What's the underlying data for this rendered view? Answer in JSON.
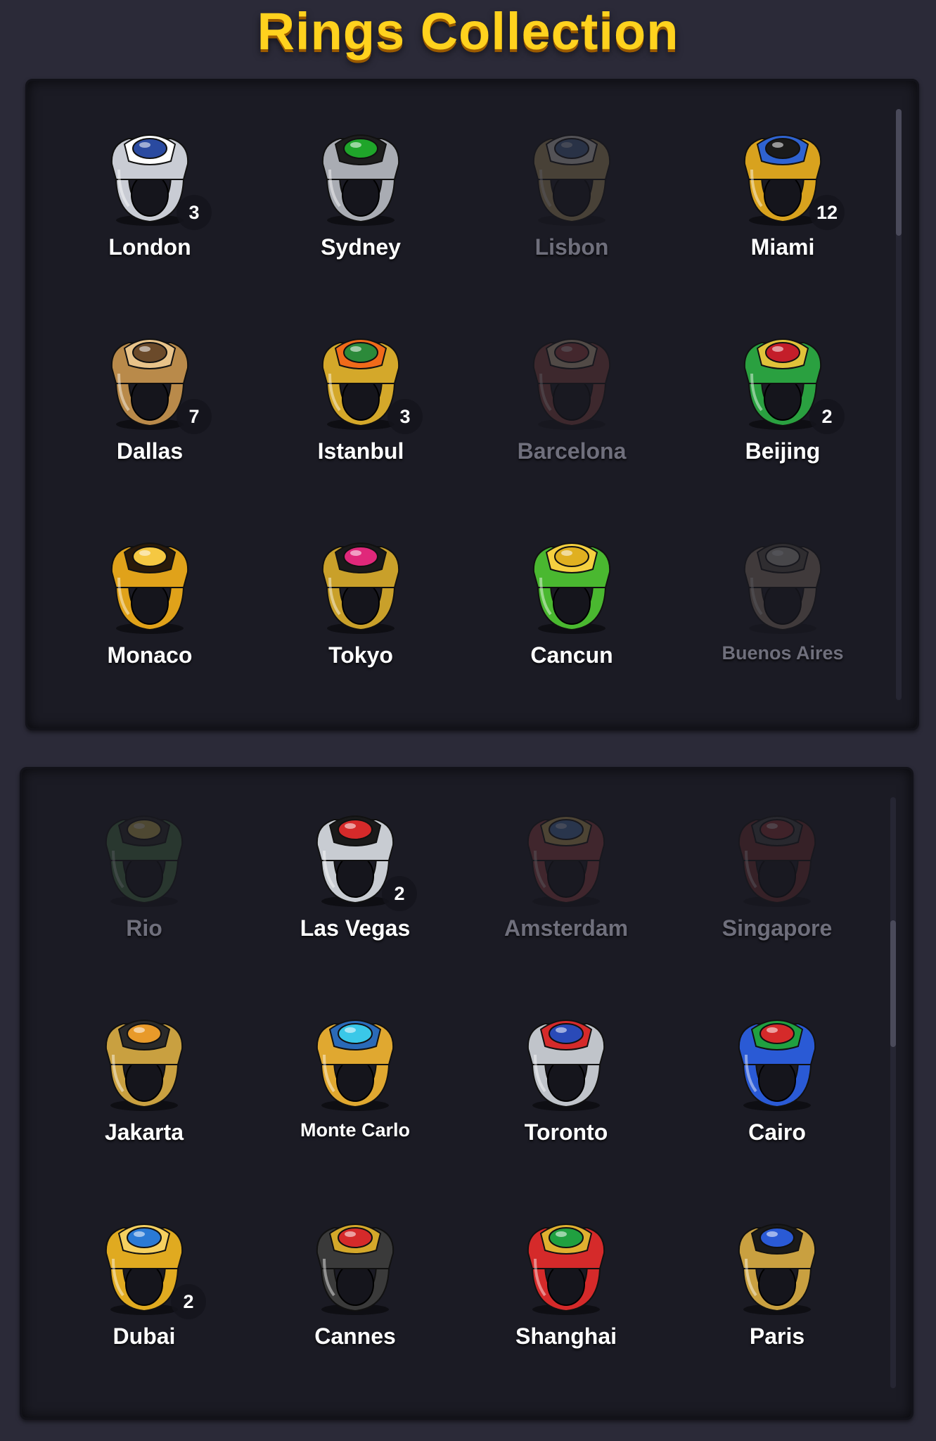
{
  "title": "Rings Collection",
  "top_panel": {
    "rings": [
      {
        "name": "London",
        "count": "3",
        "locked": false,
        "band": "#c9ccd4",
        "gem": "#2a4aa0",
        "accent": "#ffffff"
      },
      {
        "name": "Sydney",
        "count": "",
        "locked": false,
        "band": "#a9acb3",
        "gem": "#1fa52a",
        "accent": "#1e1e1e"
      },
      {
        "name": "Lisbon",
        "count": "",
        "locked": true,
        "band": "#c8a24a",
        "gem": "#3f6fb8",
        "accent": "#e8e0d0"
      },
      {
        "name": "Miami",
        "count": "12",
        "locked": false,
        "band": "#d8a21e",
        "gem": "#1a1a1a",
        "accent": "#2f63d1"
      },
      {
        "name": "Dallas",
        "count": "7",
        "locked": false,
        "band": "#b98a4a",
        "gem": "#6b4a2a",
        "accent": "#e8c38a"
      },
      {
        "name": "Istanbul",
        "count": "3",
        "locked": false,
        "band": "#d4a82a",
        "gem": "#2c8a3a",
        "accent": "#f06a1a"
      },
      {
        "name": "Barcelona",
        "count": "",
        "locked": true,
        "band": "#b8423a",
        "gem": "#d53a3a",
        "accent": "#e8c38a"
      },
      {
        "name": "Beijing",
        "count": "2",
        "locked": false,
        "band": "#2aa040",
        "gem": "#c41e2a",
        "accent": "#e0c23a"
      },
      {
        "name": "Monaco",
        "count": "",
        "locked": false,
        "band": "#e0a21a",
        "gem": "#f5c842",
        "accent": "#2a1a0a"
      },
      {
        "name": "Tokyo",
        "count": "",
        "locked": false,
        "band": "#c9a02a",
        "gem": "#e0287a",
        "accent": "#1a1a1a"
      },
      {
        "name": "Cancun",
        "count": "",
        "locked": false,
        "band": "#4ab830",
        "gem": "#e0b020",
        "accent": "#f5d040"
      },
      {
        "name": "Buenos Aires",
        "count": "",
        "locked": true,
        "band": "#a88a6a",
        "gem": "#c0b8a8",
        "accent": "#6a5a4a"
      }
    ]
  },
  "bottom_panel": {
    "rings": [
      {
        "name": "Rio",
        "count": "",
        "locked": true,
        "band": "#3a8a3a",
        "gem": "#e0c020",
        "accent": "#2a2a2a"
      },
      {
        "name": "Las Vegas",
        "count": "2",
        "locked": false,
        "band": "#c8ccd2",
        "gem": "#d52a2a",
        "accent": "#1a1a1a"
      },
      {
        "name": "Amsterdam",
        "count": "",
        "locked": true,
        "band": "#c83a3a",
        "gem": "#3a7ad5",
        "accent": "#e0b030"
      },
      {
        "name": "Singapore",
        "count": "",
        "locked": true,
        "band": "#9a2a2a",
        "gem": "#c82a2a",
        "accent": "#4a4a4a"
      },
      {
        "name": "Jakarta",
        "count": "",
        "locked": false,
        "band": "#c9a040",
        "gem": "#e89a2a",
        "accent": "#2a2a2a"
      },
      {
        "name": "Monte Carlo",
        "count": "",
        "locked": false,
        "band": "#e0a830",
        "gem": "#3ac8e8",
        "accent": "#2a6ab8"
      },
      {
        "name": "Toronto",
        "count": "",
        "locked": false,
        "band": "#c0c4ca",
        "gem": "#2a4ab8",
        "accent": "#d52a2a"
      },
      {
        "name": "Cairo",
        "count": "",
        "locked": false,
        "band": "#2a5ad5",
        "gem": "#d52a2a",
        "accent": "#20a040"
      },
      {
        "name": "Dubai",
        "count": "2",
        "locked": false,
        "band": "#e0aa20",
        "gem": "#2a7ad5",
        "accent": "#f5d060"
      },
      {
        "name": "Cannes",
        "count": "",
        "locked": false,
        "band": "#3a3a3a",
        "gem": "#d52a2a",
        "accent": "#d4a82a"
      },
      {
        "name": "Shanghai",
        "count": "",
        "locked": false,
        "band": "#d52a2a",
        "gem": "#20a040",
        "accent": "#e0b030"
      },
      {
        "name": "Paris",
        "count": "",
        "locked": false,
        "band": "#c9a040",
        "gem": "#2a5ad5",
        "accent": "#1a1a1a"
      }
    ]
  }
}
